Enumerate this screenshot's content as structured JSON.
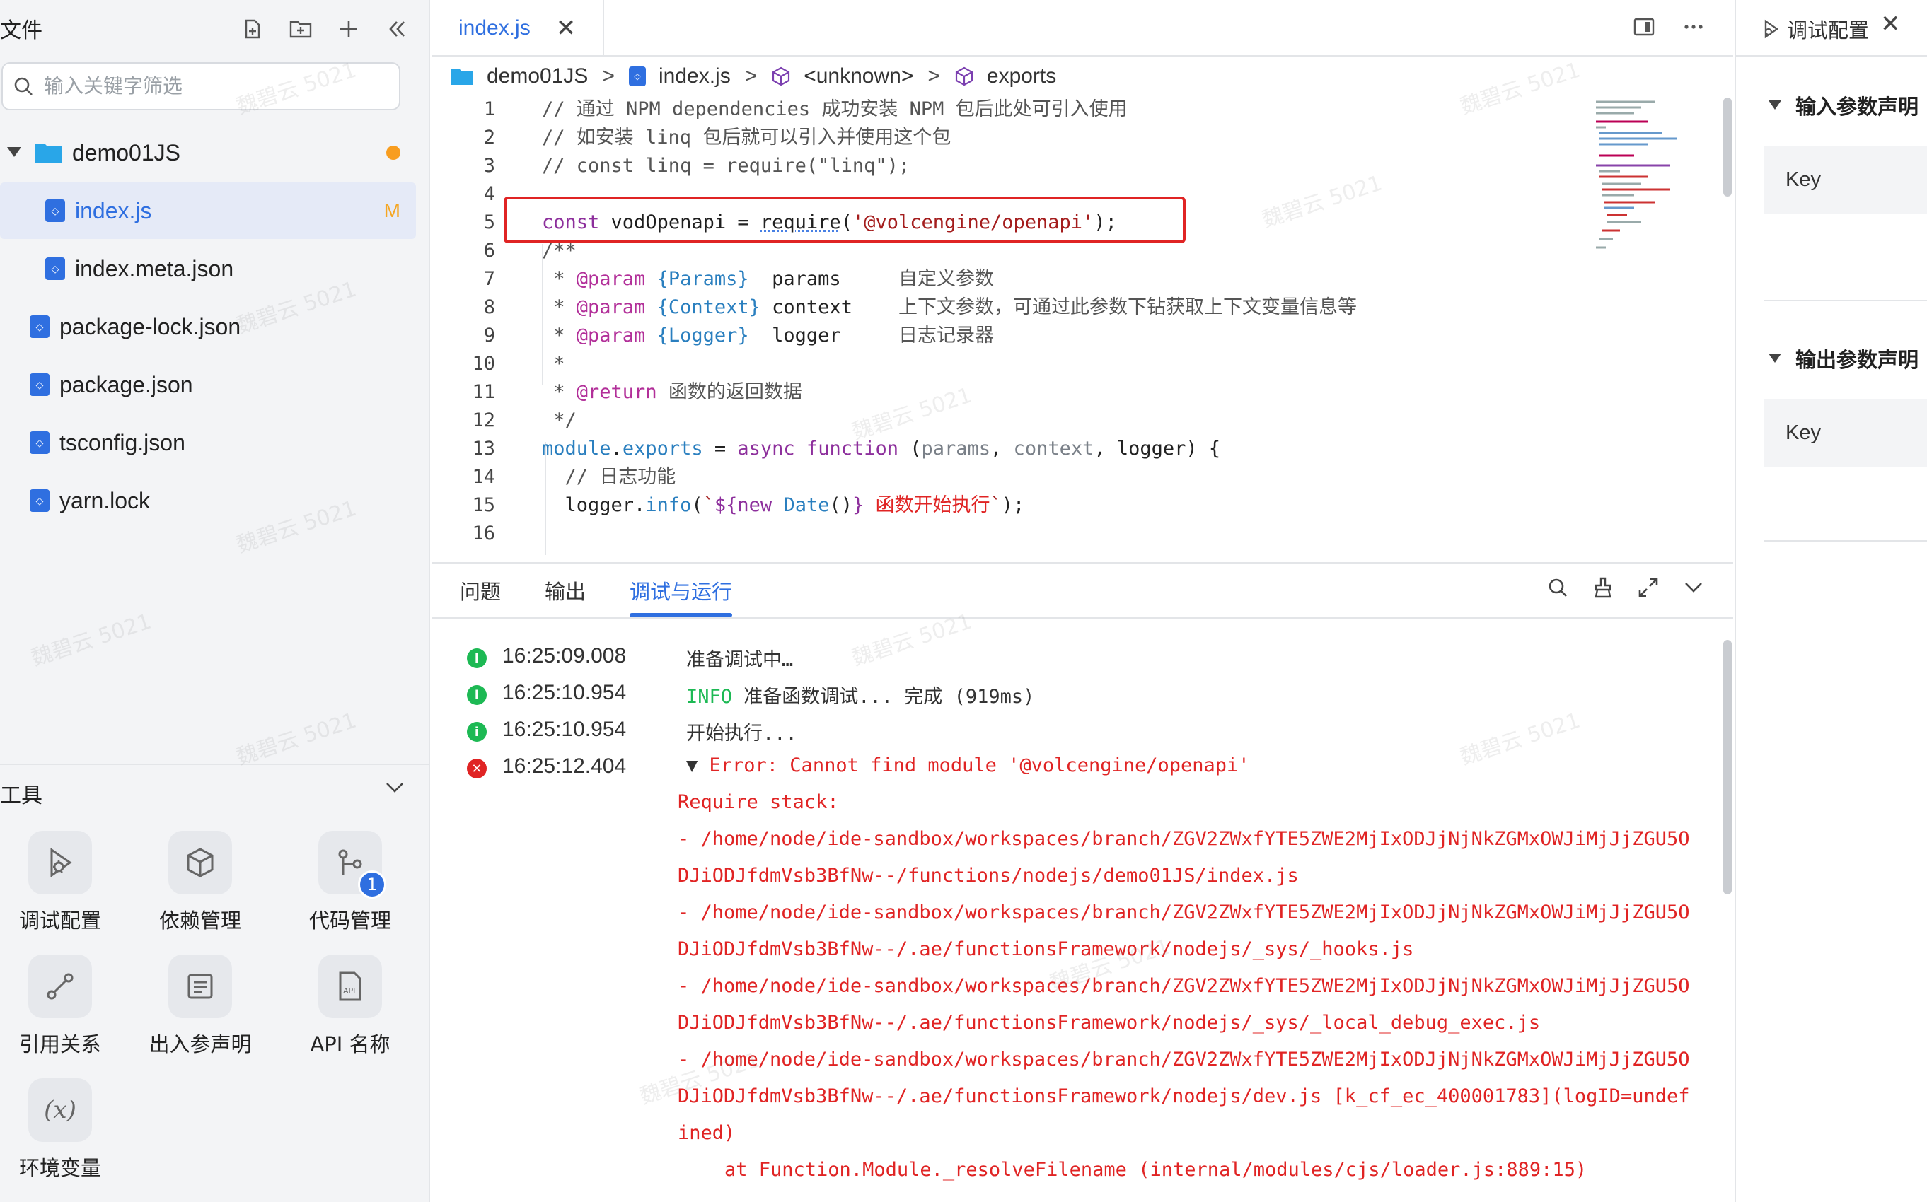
{
  "sidebar": {
    "title": "文件",
    "search_placeholder": "输入关键字筛选",
    "tree": [
      {
        "label": "demo01JS",
        "type": "folder"
      },
      {
        "label": "index.js",
        "badge": "M"
      },
      {
        "label": "index.meta.json"
      },
      {
        "label": "package-lock.json"
      },
      {
        "label": "package.json"
      },
      {
        "label": "tsconfig.json"
      },
      {
        "label": "yarn.lock"
      }
    ],
    "tools_title": "工具",
    "tools": [
      {
        "label": "调试配置",
        "icon": "debug-config-icon"
      },
      {
        "label": "依赖管理",
        "icon": "package-icon"
      },
      {
        "label": "代码管理",
        "icon": "git-icon",
        "badge": "1"
      },
      {
        "label": "引用关系",
        "icon": "reference-icon"
      },
      {
        "label": "出入参声明",
        "icon": "params-icon"
      },
      {
        "label": "API 名称",
        "icon": "api-icon"
      },
      {
        "label": "环境变量",
        "icon": "variable-icon"
      }
    ]
  },
  "editor": {
    "tab": "index.js",
    "breadcrumb": [
      "demo01JS",
      "index.js",
      "<unknown>",
      "exports"
    ],
    "line_numbers": [
      "1",
      "2",
      "3",
      "4",
      "5",
      "6",
      "7",
      "8",
      "9",
      "10",
      "11",
      "12",
      "13",
      "14",
      "15",
      "16"
    ]
  },
  "panel": {
    "tabs": [
      "问题",
      "输出",
      "调试与运行"
    ],
    "active_tab": "调试与运行",
    "logs": [
      {
        "status": "ok",
        "time": "16:25:09.008",
        "msg": "准备调试中…"
      },
      {
        "status": "ok",
        "time": "16:25:10.954",
        "level": "INFO",
        "msg": " 准备函数调试... 完成 (919ms)"
      },
      {
        "status": "ok",
        "time": "16:25:10.954",
        "msg": "开始执行..."
      },
      {
        "status": "err",
        "time": "16:25:12.404",
        "msg": "Error: Cannot find module '@volcengine/openapi'"
      }
    ],
    "error_detail": [
      "Require stack:",
      "- /home/node/ide-sandbox/workspaces/branch/ZGV2ZWxfYTE5ZWE2MjIxODJjNjNkZGMxOWJiMjJjZGU5O",
      "DJiODJfdmVsb3BfNw--/functions/nodejs/demo01JS/index.js",
      "- /home/node/ide-sandbox/workspaces/branch/ZGV2ZWxfYTE5ZWE2MjIxODJjNjNkZGMxOWJiMjJjZGU5O",
      "DJiODJfdmVsb3BfNw--/.ae/functionsFramework/nodejs/_sys/_hooks.js",
      "- /home/node/ide-sandbox/workspaces/branch/ZGV2ZWxfYTE5ZWE2MjIxODJjNjNkZGMxOWJiMjJjZGU5O",
      "DJiODJfdmVsb3BfNw--/.ae/functionsFramework/nodejs/_sys/_local_debug_exec.js",
      "- /home/node/ide-sandbox/workspaces/branch/ZGV2ZWxfYTE5ZWE2MjIxODJjNjNkZGMxOWJiMjJjZGU5O",
      "DJiODJfdmVsb3BfNw--/.ae/functionsFramework/nodejs/dev.js [k_cf_ec_400001783](logID=undef",
      "ined)"
    ],
    "stack_at": "at Function.Module._resolveFilename (internal/modules/cjs/loader.js:889:15)"
  },
  "rightpanel": {
    "title": "调试配置",
    "section_input": "输入参数声明",
    "section_output": "输出参数声明",
    "key_label": "Key"
  },
  "watermark": "魏碧云 5021",
  "colors": {
    "accent": "#2f6fe0",
    "error": "#e02424",
    "success": "#1db954",
    "modified": "#f5a623"
  }
}
